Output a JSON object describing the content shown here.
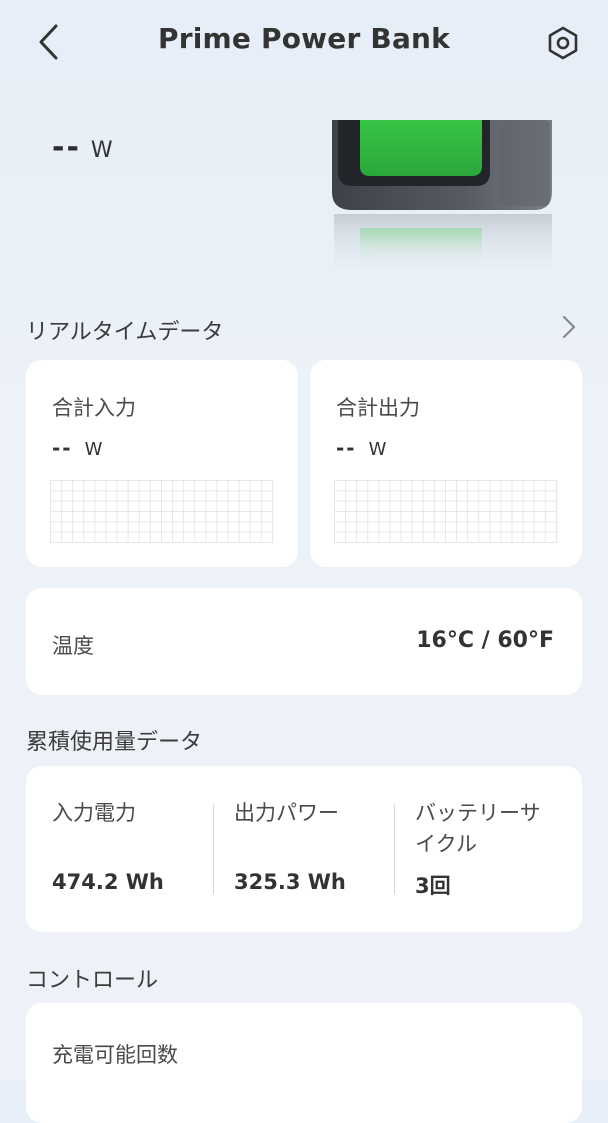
{
  "header": {
    "title": "Prime Power Bank"
  },
  "power": {
    "value": "--",
    "unit": "W"
  },
  "realtime": {
    "section_title": "リアルタイムデータ",
    "total_input": {
      "label": "合計入力",
      "value": "--",
      "unit": "W"
    },
    "total_output": {
      "label": "合計出力",
      "value": "--",
      "unit": "W"
    }
  },
  "temperature": {
    "label": "温度",
    "value": "16°C / 60°F"
  },
  "cumulative": {
    "section_title": "累積使用量データ",
    "input_power": {
      "label": "入力電力",
      "value": "474.2 Wh"
    },
    "output_power": {
      "label": "出力パワー",
      "value": "325.3 Wh"
    },
    "battery_cycle": {
      "label": "バッテリーサイクル",
      "label_line1": "バッテリーサ",
      "label_line2": "イクル",
      "value": "3回"
    }
  },
  "control": {
    "section_title": "コントロール",
    "charge_count_label": "充電可能回数"
  },
  "colors": {
    "background": "#e9eff7",
    "card": "#ffffff",
    "device_screen": "#2fbf3c",
    "device_body": "#4a4e55",
    "text_primary": "#333333"
  },
  "icons": {
    "back": "chevron-left-icon",
    "settings": "hexagon-gear-icon",
    "more": "chevron-right-icon"
  }
}
